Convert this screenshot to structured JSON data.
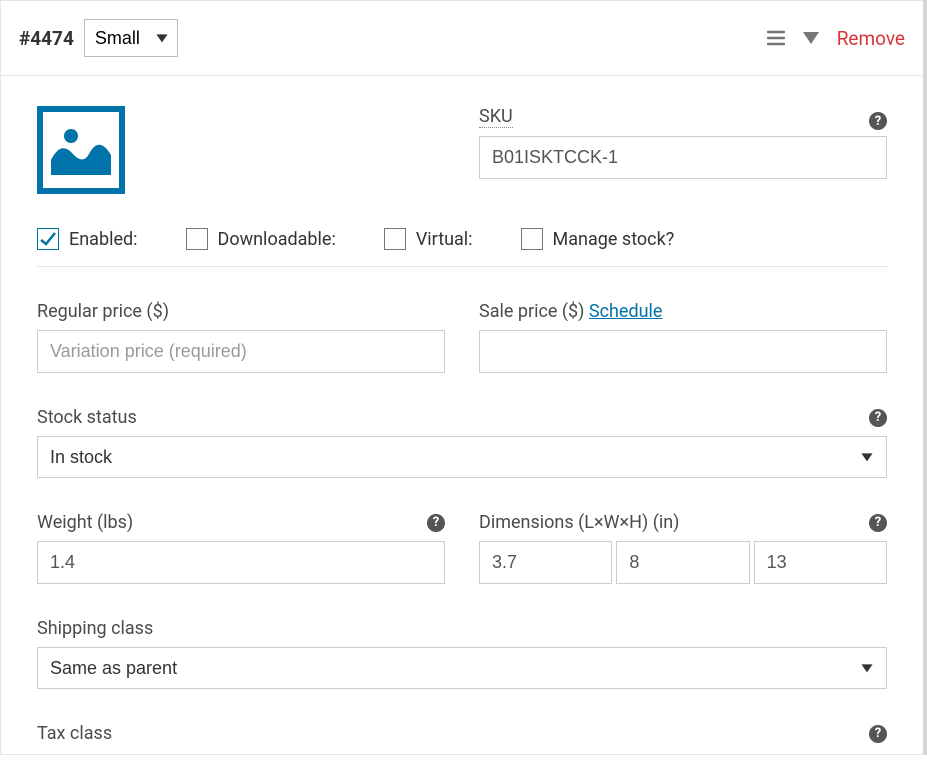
{
  "variation": {
    "id_label": "#4474",
    "attribute_selected": "Small",
    "remove_label": "Remove"
  },
  "sku": {
    "label": "SKU",
    "value": "B01ISKTCCK-1"
  },
  "checkboxes": {
    "enabled": {
      "label": "Enabled:",
      "checked": true
    },
    "downloadable": {
      "label": "Downloadable:",
      "checked": false
    },
    "virtual": {
      "label": "Virtual:",
      "checked": false
    },
    "manage_stock": {
      "label": "Manage stock?",
      "checked": false
    }
  },
  "price": {
    "regular_label": "Regular price ($)",
    "regular_placeholder": "Variation price (required)",
    "regular_value": "",
    "sale_label": "Sale price ($)",
    "sale_value": "",
    "schedule_label": "Schedule"
  },
  "stock_status": {
    "label": "Stock status",
    "value": "In stock"
  },
  "weight": {
    "label": "Weight (lbs)",
    "value": "1.4"
  },
  "dimensions": {
    "label": "Dimensions (L×W×H) (in)",
    "length": "3.7",
    "width": "8",
    "height": "13"
  },
  "shipping_class": {
    "label": "Shipping class",
    "value": "Same as parent"
  },
  "tax_class": {
    "label": "Tax class"
  },
  "icons": {
    "help": "?",
    "menu": "hamburger-icon",
    "caret": "caret-down-icon"
  }
}
